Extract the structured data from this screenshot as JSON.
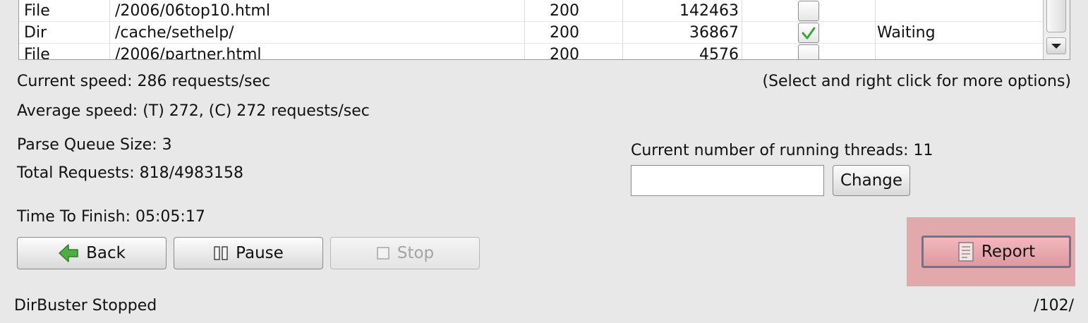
{
  "table": {
    "rows": [
      {
        "type": "File",
        "path": "/2006/06top10.html",
        "status": "200",
        "size": "142463",
        "checked": false,
        "state": ""
      },
      {
        "type": "Dir",
        "path": "/cache/sethelp/",
        "status": "200",
        "size": "36867",
        "checked": true,
        "state": "Waiting"
      },
      {
        "type": "File",
        "path": "/2006/partner.html",
        "status": "200",
        "size": "4576",
        "checked": false,
        "state": ""
      }
    ]
  },
  "stats": {
    "current_speed": "Current speed: 286 requests/sec",
    "hint": "(Select and right click for more options)",
    "average_speed": "Average speed: (T) 272, (C) 272 requests/sec",
    "parse_queue": "Parse Queue Size: 3",
    "total_requests": "Total Requests: 818/4983158",
    "time_to_finish": "Time To Finish: 05:05:17"
  },
  "threads": {
    "label": "Current number of running threads: 11",
    "input_value": "",
    "change_label": "Change"
  },
  "buttons": {
    "back": "Back",
    "pause": "Pause",
    "stop": "Stop",
    "report": "Report"
  },
  "status_bar": {
    "left": "DirBuster Stopped",
    "right": "/102/"
  },
  "colors": {
    "checkmark": "#3aa53a",
    "back_arrow": "#4caf3f",
    "report_highlight": "#e2a9ad"
  },
  "icons": {
    "back": "back-arrow-icon",
    "pause": "pause-icon",
    "stop": "stop-icon",
    "report": "report-document-icon",
    "scroll_down": "scroll-down-arrow-icon",
    "check": "checkmark-icon"
  }
}
